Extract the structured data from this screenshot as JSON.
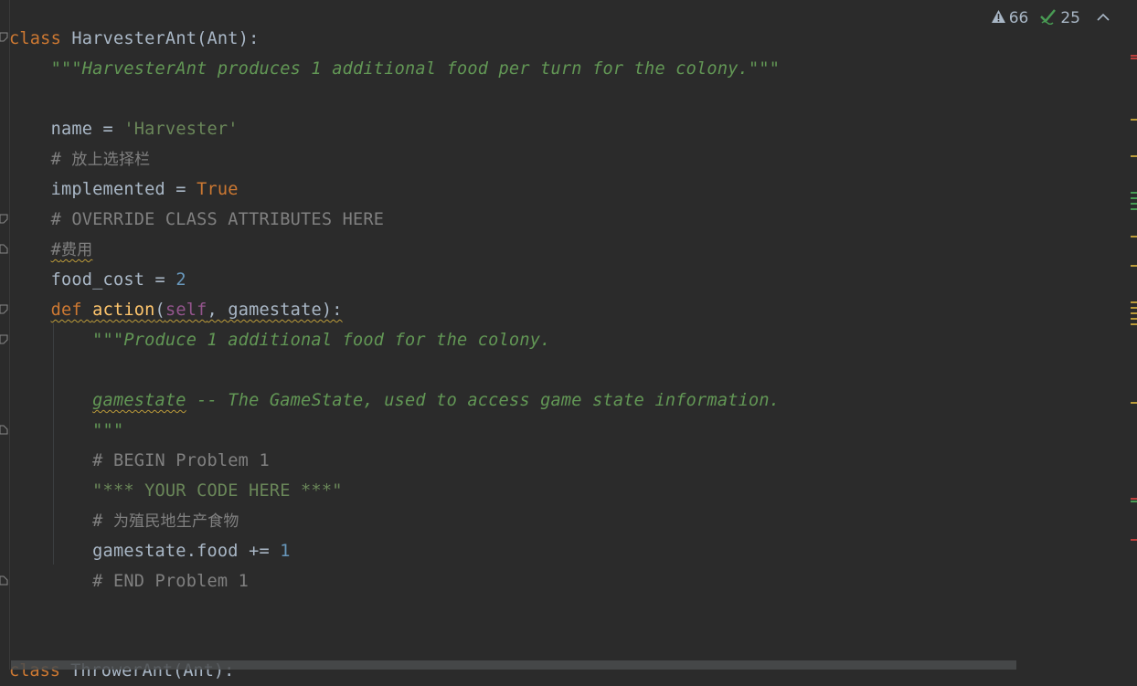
{
  "inspection": {
    "warnings": "66",
    "weak_warnings": "25"
  },
  "code": {
    "l1_kw": "class",
    "l1_rest": " HarvesterAnt(Ant):",
    "l2_doc": "    \"\"\"HarvesterAnt produces 1 additional food per turn for the colony.\"\"\"",
    "l4_a": "    name = ",
    "l4_str": "'Harvester'",
    "l5_cmt": "    # ",
    "l5_cjk": "放上选择栏",
    "l6_a": "    implemented = ",
    "l6_kw": "True",
    "l7_cmt": "    # OVERRIDE CLASS ATTRIBUTES HERE",
    "l8_pre": "    ",
    "l8_cmt": "#",
    "l8_cjk": "费用",
    "l9_a": "    food_cost = ",
    "l9_num": "2",
    "l10_pre": "    ",
    "l10_kw": "def",
    "l10_sp": " ",
    "l10_fn": "action",
    "l10_p1": "(",
    "l10_self": "self",
    "l10_p2": ", gamestate):",
    "l11_doc": "        \"\"\"Produce 1 additional food for the colony.",
    "l13_pre": "        ",
    "l13_doc_u": "gamestate",
    "l13_doc": " -- The GameState, used to access game state information.",
    "l14_doc": "        \"\"\"",
    "l15_cmt": "        # BEGIN Problem 1",
    "l16_str": "        \"*** YOUR CODE HERE ***\"",
    "l17_cmt": "        # ",
    "l17_cjk": "为殖民地生产食物",
    "l18_a": "        gamestate.food += ",
    "l18_num": "1",
    "l19_cmt": "        # END Problem 1",
    "cut_kw": "class",
    "cut_rest": " ThrowerAnt(Ant):"
  },
  "colors": {
    "background": "#2b2b2b",
    "keyword": "#cc7832",
    "function": "#ffc66d",
    "docstring": "#629755",
    "string": "#6a8759",
    "comment": "#808080",
    "number": "#6897bb",
    "self": "#94558d",
    "warning": "#bc9b3a",
    "ok": "#499c54"
  }
}
